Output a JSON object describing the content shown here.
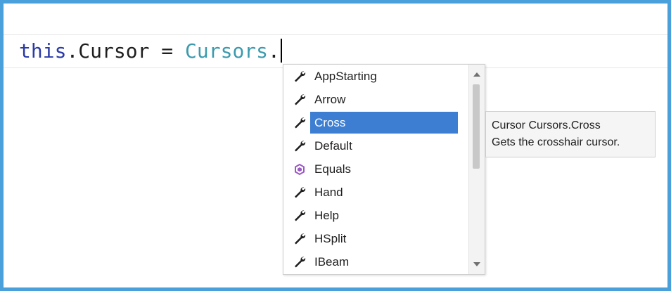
{
  "editor": {
    "code": {
      "keyword": "this",
      "middle": ".Cursor = ",
      "type_name": "Cursors",
      "trailing": "."
    }
  },
  "completion": {
    "items": [
      {
        "label": "AppStarting",
        "icon": "wrench-icon"
      },
      {
        "label": "Arrow",
        "icon": "wrench-icon"
      },
      {
        "label": "Cross",
        "icon": "wrench-icon",
        "selected": true
      },
      {
        "label": "Default",
        "icon": "wrench-icon"
      },
      {
        "label": "Equals",
        "icon": "method-icon"
      },
      {
        "label": "Hand",
        "icon": "wrench-icon"
      },
      {
        "label": "Help",
        "icon": "wrench-icon"
      },
      {
        "label": "HSplit",
        "icon": "wrench-icon"
      },
      {
        "label": "IBeam",
        "icon": "wrench-icon"
      }
    ],
    "selected_index": 2
  },
  "tooltip": {
    "signature": "Cursor Cursors.Cross",
    "description": "Gets the crosshair cursor."
  },
  "colors": {
    "frame_border": "#4aa0da",
    "selection": "#3d7ed2",
    "keyword": "#2a3aa8",
    "type": "#3b9aae",
    "method_icon": "#9b59c5"
  }
}
